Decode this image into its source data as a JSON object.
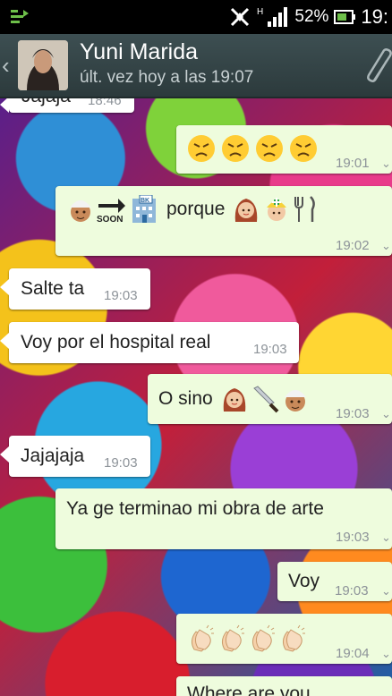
{
  "statusbar": {
    "battery": "52%",
    "time": "19:"
  },
  "header": {
    "back_glyph": "‹",
    "contact_name": "Yuni Marida",
    "last_seen": "últ. vez hoy a las 19:07"
  },
  "messages": [
    {
      "dir": "in",
      "text": "Jajaja",
      "time": "18:46"
    },
    {
      "dir": "out",
      "text": "",
      "emojis": [
        "angry-face-icon",
        "angry-face-icon",
        "angry-face-icon",
        "angry-face-icon"
      ],
      "time": "19:01"
    },
    {
      "dir": "out",
      "text": "porque",
      "emojis_before": [
        "man-turban-icon",
        "arrow-right-icon",
        "building-icon"
      ],
      "soon_label": "SOON",
      "building_label": "BK",
      "emojis_after": [
        "woman-icon",
        "nurse-icon",
        "fork-knife-icon"
      ],
      "time": "19:02"
    },
    {
      "dir": "in",
      "text": "Salte ta",
      "time": "19:03"
    },
    {
      "dir": "in",
      "text": "Voy por el hospital real",
      "time": "19:03"
    },
    {
      "dir": "out",
      "text": "O sino",
      "emojis": [
        "woman-icon",
        "knife-icon",
        "man-turban-icon"
      ],
      "time": "19:03"
    },
    {
      "dir": "in",
      "text": "Jajajaja",
      "time": "19:03"
    },
    {
      "dir": "out",
      "text": "Ya ge terminao mi obra de arte",
      "time": "19:03"
    },
    {
      "dir": "out",
      "text": "Voy",
      "time": "19:03"
    },
    {
      "dir": "out",
      "text": "",
      "emojis": [
        "clapping-hands-icon",
        "clapping-hands-icon",
        "clapping-hands-icon",
        "clapping-hands-icon"
      ],
      "time": "19:04"
    },
    {
      "dir": "out",
      "text": "Where are you",
      "time": ""
    }
  ],
  "colors": {
    "incoming_bubble": "#ffffff",
    "outgoing_bubble": "#eefcdd",
    "header": "#34464a"
  }
}
